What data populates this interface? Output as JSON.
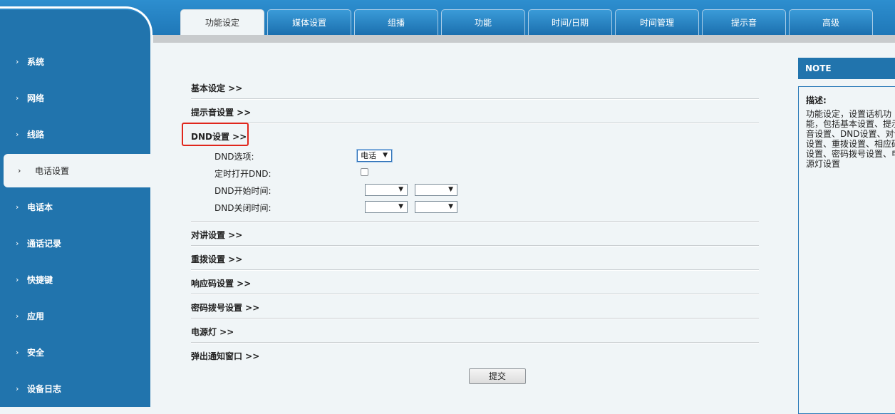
{
  "tabs": [
    {
      "label": "功能设定",
      "active": true
    },
    {
      "label": "媒体设置"
    },
    {
      "label": "组播"
    },
    {
      "label": "功能"
    },
    {
      "label": "时间/日期"
    },
    {
      "label": "时间管理"
    },
    {
      "label": "提示音"
    },
    {
      "label": "高级"
    }
  ],
  "sidebar": {
    "items": [
      {
        "label": "系统"
      },
      {
        "label": "网络"
      },
      {
        "label": "线路"
      },
      {
        "label": "电话设置",
        "active": true
      },
      {
        "label": "电话本"
      },
      {
        "label": "通话记录"
      },
      {
        "label": "快捷键"
      },
      {
        "label": "应用"
      },
      {
        "label": "安全"
      },
      {
        "label": "设备日志"
      }
    ],
    "chevron": "›"
  },
  "sections": {
    "basic": "基本设定 >>",
    "tone": "提示音设置 >>",
    "dnd": "DND设置 >>",
    "intercom": "对讲设置 >>",
    "redial": "重拨设置 >>",
    "response_code": "响应码设置 >>",
    "password_dial": "密码拨号设置 >>",
    "power_led": "电源灯 >>",
    "popup": "弹出通知窗口 >>"
  },
  "dnd": {
    "option_label": "DND选项:",
    "option_value": "电话",
    "timer_label": "定时打开DND:",
    "timer_checked": false,
    "start_label": "DND开始时间:",
    "end_label": "DND关闭时间:",
    "start_hour": "",
    "start_minute": "",
    "end_hour": "",
    "end_minute": ""
  },
  "submit_label": "提交",
  "note": {
    "header": "NOTE",
    "title": "描述:",
    "text": "功能设定，设置话机功能，包括基本设置、提示音设置、DND设置、对讲设置、重拨设置、相应码设置、密码拨号设置、电源灯设置"
  },
  "colors": {
    "primary": "#2174ad",
    "highlight_box": "#e0261c",
    "background": "#f0f5f7"
  }
}
